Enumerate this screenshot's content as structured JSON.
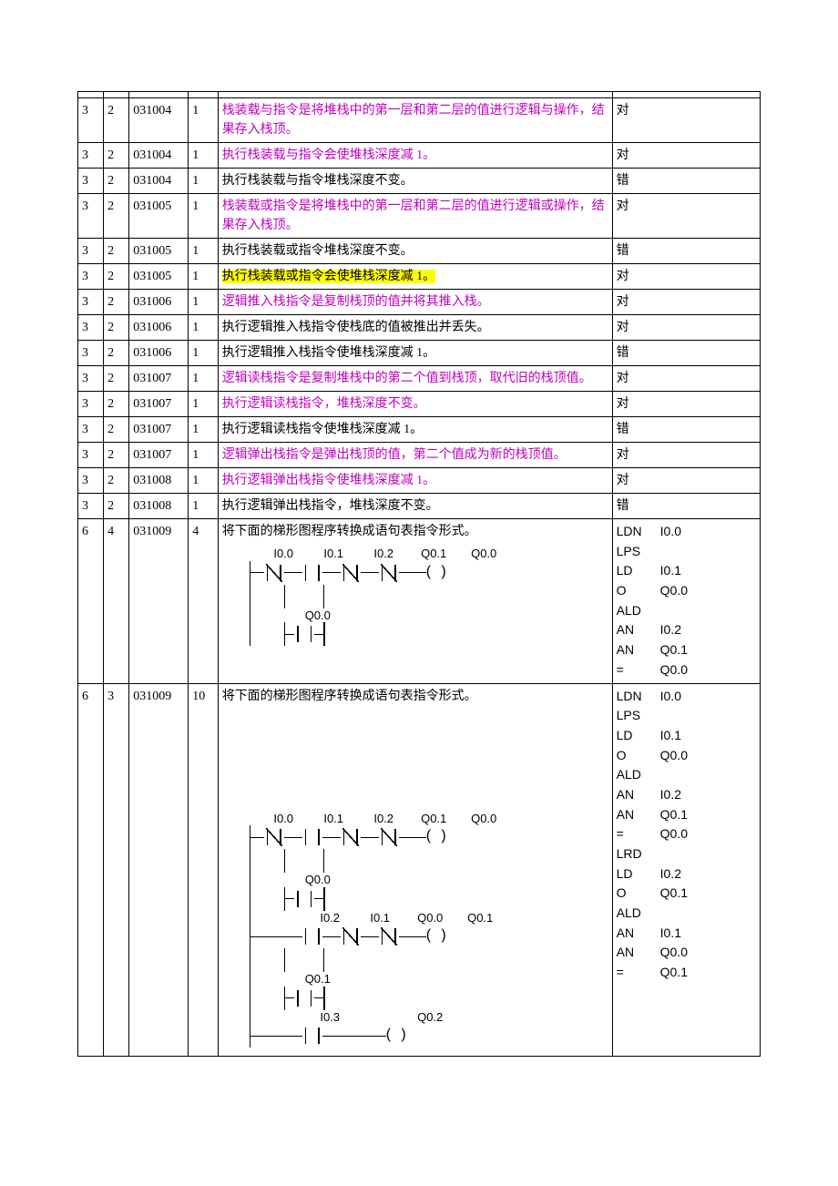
{
  "rows": [
    {
      "c1": "",
      "c2": "",
      "c3": "",
      "c4": "",
      "q": "",
      "a": "",
      "cls": ""
    },
    {
      "c1": "3",
      "c2": "2",
      "c3": "031004",
      "c4": "1",
      "q": "栈装载与指令是将堆栈中的第一层和第二层的值进行逻辑与操作，结果存入栈顶。",
      "a": "对",
      "cls": "pink"
    },
    {
      "c1": "3",
      "c2": "2",
      "c3": "031004",
      "c4": "1",
      "q": "执行栈装载与指令会使堆栈深度减 1。",
      "a": "对",
      "cls": "pink"
    },
    {
      "c1": "3",
      "c2": "2",
      "c3": "031004",
      "c4": "1",
      "q": "执行栈装载与指令堆栈深度不变。",
      "a": "错",
      "cls": ""
    },
    {
      "c1": "3",
      "c2": "2",
      "c3": "031005",
      "c4": "1",
      "q": "栈装载或指令是将堆栈中的第一层和第二层的值进行逻辑或操作，结果存入栈顶。",
      "a": "对",
      "cls": "pink"
    },
    {
      "c1": "3",
      "c2": "2",
      "c3": "031005",
      "c4": "1",
      "q": "执行栈装载或指令堆栈深度不变。",
      "a": "错",
      "cls": ""
    },
    {
      "c1": "3",
      "c2": "2",
      "c3": "031005",
      "c4": "1",
      "q": "执行栈装载或指令会使堆栈深度减 1。",
      "a": "对",
      "cls": "hl"
    },
    {
      "c1": "3",
      "c2": "2",
      "c3": "031006",
      "c4": "1",
      "q": "逻辑推入栈指令是复制栈顶的值并将其推入栈。",
      "a": "对",
      "cls": "pink"
    },
    {
      "c1": "3",
      "c2": "2",
      "c3": "031006",
      "c4": "1",
      "q": "执行逻辑推入栈指令使栈底的值被推出并丢失。",
      "a": "对",
      "cls": ""
    },
    {
      "c1": "3",
      "c2": "2",
      "c3": "031006",
      "c4": "1",
      "q": "执行逻辑推入栈指令使堆栈深度减 1。",
      "a": "错",
      "cls": ""
    },
    {
      "c1": "3",
      "c2": "2",
      "c3": "031007",
      "c4": "1",
      "q": "逻辑读栈指令是复制堆栈中的第二个值到栈顶，取代旧的栈顶值。",
      "a": "对",
      "cls": "pink"
    },
    {
      "c1": "3",
      "c2": "2",
      "c3": "031007",
      "c4": "1",
      "q": "执行逻辑读栈指令，堆栈深度不变。",
      "a": "对",
      "cls": "pink"
    },
    {
      "c1": "3",
      "c2": "2",
      "c3": "031007",
      "c4": "1",
      "q": "执行逻辑读栈指令使堆栈深度减 1。",
      "a": "错",
      "cls": ""
    },
    {
      "c1": "3",
      "c2": "2",
      "c3": "031007",
      "c4": "1",
      "q": "逻辑弹出栈指令是弹出栈顶的值，第二个值成为新的栈顶值。",
      "a": "对",
      "cls": "pink"
    },
    {
      "c1": "3",
      "c2": "2",
      "c3": "031008",
      "c4": "1",
      "q": "执行逻辑弹出栈指令使堆栈深度减 1。",
      "a": "对",
      "cls": "pink"
    },
    {
      "c1": "3",
      "c2": "2",
      "c3": "031008",
      "c4": "1",
      "q": "执行逻辑弹出栈指令，堆栈深度不变。",
      "a": "错",
      "cls": ""
    }
  ],
  "ladder1": {
    "c1": "6",
    "c2": "4",
    "c3": "031009",
    "c4": "4",
    "prompt": "将下面的梯形图程序转换成语句表指令形式。",
    "topSignals": [
      "I0.0",
      "I0.1",
      "I0.2",
      "Q0.1",
      "Q0.0"
    ],
    "branchSignal": "Q0.0",
    "stl": [
      [
        "LDN",
        "I0.0"
      ],
      [
        "LPS",
        ""
      ],
      [
        "LD",
        "I0.1"
      ],
      [
        "O",
        "Q0.0"
      ],
      [
        "ALD",
        ""
      ],
      [
        "AN",
        "I0.2"
      ],
      [
        "AN",
        "Q0.1"
      ],
      [
        "=",
        "Q0.0"
      ]
    ]
  },
  "ladder2": {
    "c1": "6",
    "c2": "3",
    "c3": "031009",
    "c4": "10",
    "prompt": "将下面的梯形图程序转换成语句表指令形式。",
    "r1": [
      "I0.0",
      "I0.1",
      "I0.2",
      "Q0.1",
      "Q0.0"
    ],
    "b1": "Q0.0",
    "r2": [
      "I0.2",
      "I0.1",
      "Q0.0",
      "Q0.1"
    ],
    "b2": "Q0.1",
    "r3": [
      "I0.3",
      "Q0.2"
    ],
    "stl": [
      [
        "LDN",
        "I0.0"
      ],
      [
        "LPS",
        ""
      ],
      [
        "LD",
        "I0.1"
      ],
      [
        "O",
        "Q0.0"
      ],
      [
        "ALD",
        ""
      ],
      [
        "AN",
        "I0.2"
      ],
      [
        "AN",
        "Q0.1"
      ],
      [
        "=",
        "Q0.0"
      ],
      [
        "LRD",
        ""
      ],
      [
        "LD",
        "I0.2"
      ],
      [
        "O",
        "Q0.1"
      ],
      [
        "ALD",
        ""
      ],
      [
        "AN",
        "I0.1"
      ],
      [
        "AN",
        "Q0.0"
      ],
      [
        "=",
        "Q0.1"
      ]
    ]
  }
}
